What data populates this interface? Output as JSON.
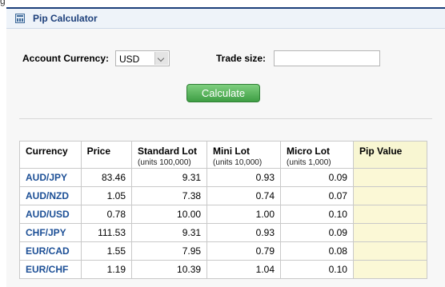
{
  "top_fragment": "g",
  "header": {
    "title": "Pip Calculator",
    "icon": "calculator-icon"
  },
  "form": {
    "account_currency_label": "Account Currency:",
    "account_currency_value": "USD",
    "trade_size_label": "Trade size:",
    "trade_size_value": ""
  },
  "calculate_label": "Calculate",
  "table": {
    "headers": [
      {
        "title": "Currency",
        "sub": ""
      },
      {
        "title": "Price",
        "sub": ""
      },
      {
        "title": "Standard Lot",
        "sub": "(units 100,000)"
      },
      {
        "title": "Mini Lot",
        "sub": "(units 10,000)"
      },
      {
        "title": "Micro Lot",
        "sub": "(units 1,000)"
      },
      {
        "title": "Pip Value",
        "sub": ""
      }
    ],
    "rows": [
      {
        "currency": "AUD/JPY",
        "price": "83.46",
        "standard": "9.31",
        "mini": "0.93",
        "micro": "0.09",
        "pip": ""
      },
      {
        "currency": "AUD/NZD",
        "price": "1.05",
        "standard": "7.38",
        "mini": "0.74",
        "micro": "0.07",
        "pip": ""
      },
      {
        "currency": "AUD/USD",
        "price": "0.78",
        "standard": "10.00",
        "mini": "1.00",
        "micro": "0.10",
        "pip": ""
      },
      {
        "currency": "CHF/JPY",
        "price": "111.53",
        "standard": "9.31",
        "mini": "0.93",
        "micro": "0.09",
        "pip": ""
      },
      {
        "currency": "EUR/CAD",
        "price": "1.55",
        "standard": "7.95",
        "mini": "0.79",
        "micro": "0.08",
        "pip": ""
      },
      {
        "currency": "EUR/CHF",
        "price": "1.19",
        "standard": "10.39",
        "mini": "1.04",
        "micro": "0.10",
        "pip": ""
      }
    ]
  },
  "colors": {
    "accent": "#1c3f7a",
    "button": "#3e9e44",
    "pip_highlight": "#fbf8d6"
  }
}
